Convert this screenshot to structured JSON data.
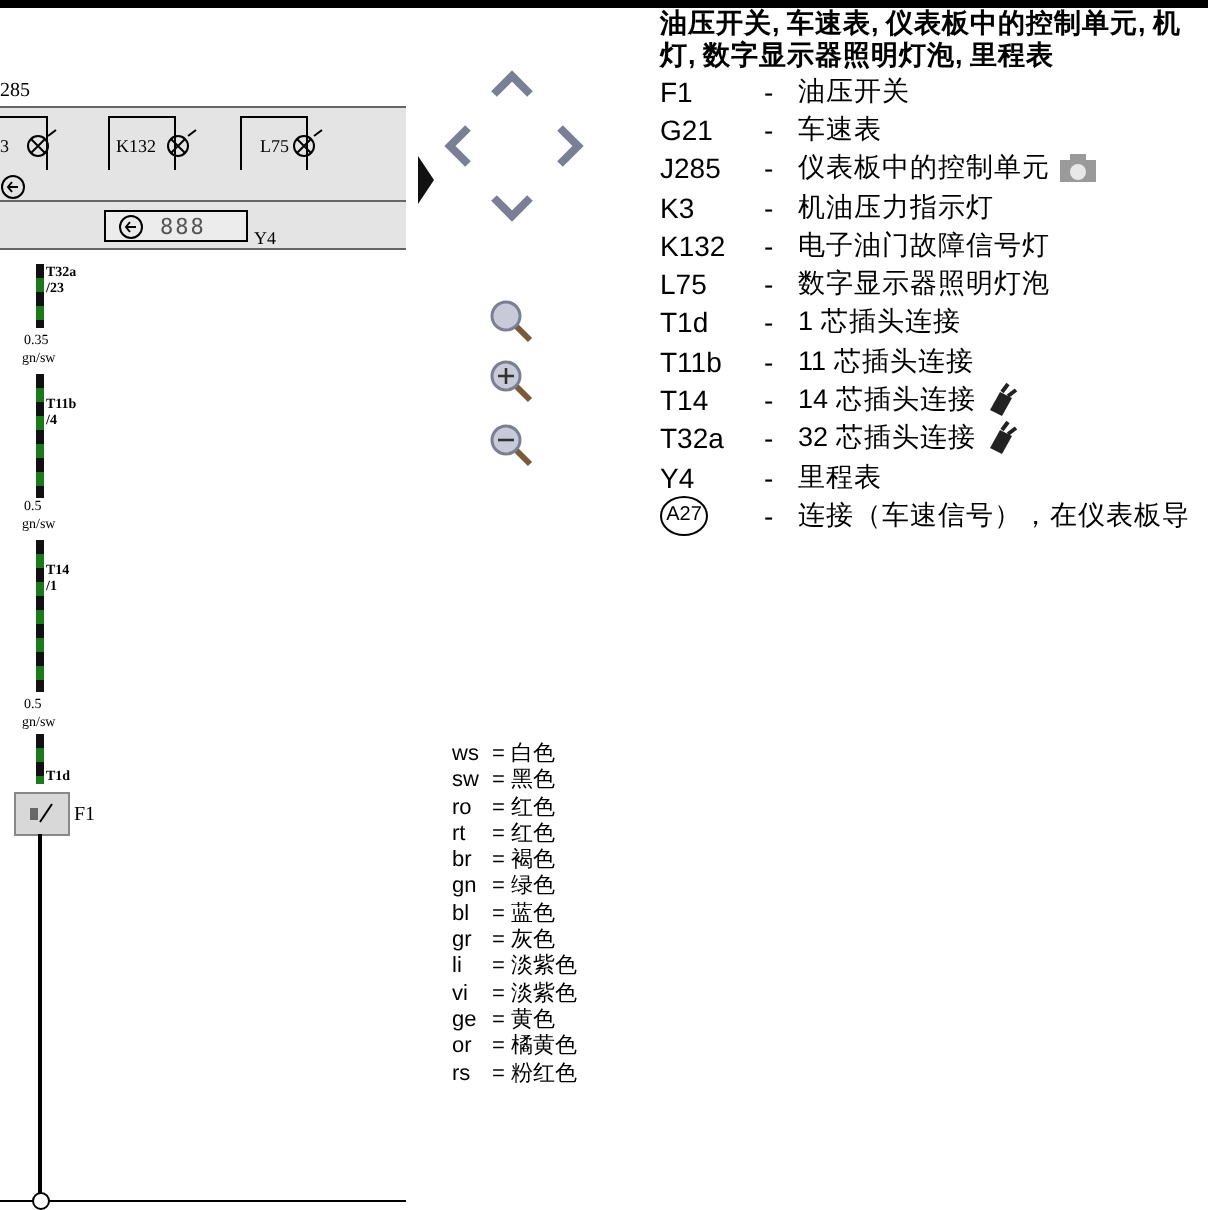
{
  "diagram": {
    "component_labels": [
      "285",
      "3",
      "K132",
      "L75",
      "Y4",
      "F1"
    ],
    "wire_labels": [
      {
        "connector": "T32a",
        "pin": "/23"
      },
      {
        "size": "0.35",
        "color_code": "gn/sw"
      },
      {
        "connector": "T11b",
        "pin": "/4"
      },
      {
        "size": "0.5",
        "color_code": "gn/sw"
      },
      {
        "connector": "T14",
        "pin": "/1"
      },
      {
        "size": "0.5",
        "color_code": "gn/sw"
      },
      {
        "connector": "T1d"
      }
    ],
    "display_digits": "888"
  },
  "color_codes": [
    {
      "code": "ws",
      "meaning": "= 白色"
    },
    {
      "code": "sw",
      "meaning": "= 黑色"
    },
    {
      "code": "ro",
      "meaning": "= 红色"
    },
    {
      "code": "rt",
      "meaning": "= 红色"
    },
    {
      "code": "br",
      "meaning": "= 褐色"
    },
    {
      "code": "gn",
      "meaning": "= 绿色"
    },
    {
      "code": "bl",
      "meaning": "= 蓝色"
    },
    {
      "code": "gr",
      "meaning": "= 灰色"
    },
    {
      "code": "li",
      "meaning": "= 淡紫色"
    },
    {
      "code": "vi",
      "meaning": "= 淡紫色"
    },
    {
      "code": "ge",
      "meaning": "= 黄色"
    },
    {
      "code": "or",
      "meaning": "= 橘黄色"
    },
    {
      "code": "rs",
      "meaning": "= 粉红色"
    }
  ],
  "legend": {
    "title_lines": [
      "油压开关, 车速表, 仪表板中的控制单元, 机",
      "灯, 数字显示器照明灯泡, 里程表"
    ],
    "items": [
      {
        "kind": "plain",
        "code": "F1",
        "dash": "-",
        "description": "油压开关"
      },
      {
        "kind": "plain",
        "code": "G21",
        "dash": "-",
        "description": "车速表"
      },
      {
        "kind": "camera",
        "code": "J285",
        "dash": "-",
        "description": "仪表板中的控制单元"
      },
      {
        "kind": "plain",
        "code": "K3",
        "dash": "-",
        "description": "机油压力指示灯"
      },
      {
        "kind": "plain",
        "code": "K132",
        "dash": "-",
        "description": "电子油门故障信号灯"
      },
      {
        "kind": "plain",
        "code": "L75",
        "dash": "-",
        "description": "数字显示器照明灯泡"
      },
      {
        "kind": "plain",
        "code": "T1d",
        "dash": "-",
        "description": "1 芯插头连接"
      },
      {
        "kind": "plain",
        "code": "T11b",
        "dash": "-",
        "description": "11 芯插头连接"
      },
      {
        "kind": "plug",
        "code": "T14",
        "dash": "-",
        "description": "14 芯插头连接"
      },
      {
        "kind": "plug",
        "code": "T32a",
        "dash": "-",
        "description": "32 芯插头连接"
      },
      {
        "kind": "plain",
        "code": "Y4",
        "dash": "-",
        "description": "里程表"
      },
      {
        "kind": "circle",
        "code": "A27",
        "dash": "-",
        "description": "连接（车速信号），在仪表板导"
      }
    ]
  }
}
